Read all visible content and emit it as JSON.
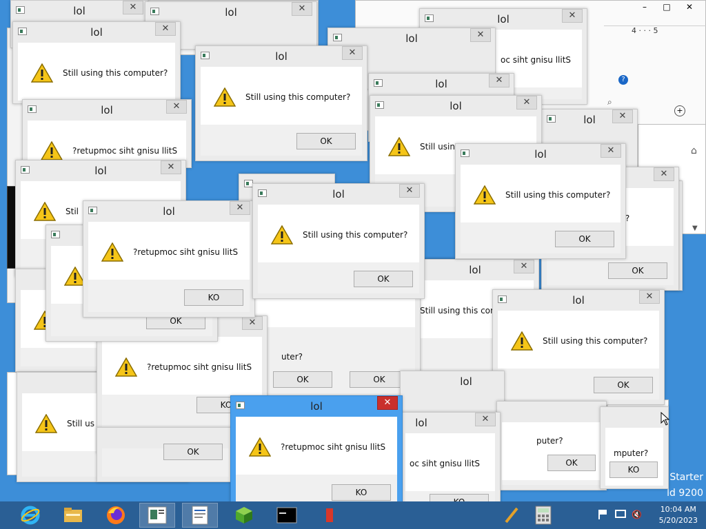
{
  "dialogs": [
    {
      "title": "lol",
      "message": "Still using this computer?",
      "ok": "OK"
    },
    {
      "title": "lol",
      "message": "?retupmoc siht gnisu llitS",
      "ok": "KO"
    }
  ],
  "labels": {
    "still": "Still using this computer?",
    "rev": "?retupmoc siht gnisu llitS",
    "ok": "OK",
    "ko": "KO",
    "lol": "lol"
  },
  "fragments": {
    "f1": "Still usi",
    "f2": "Still using t",
    "f3": "Still using this comp",
    "f4": "Still us",
    "f5": "oc siht gnisu llitS",
    "f6": "moc siht gnisu llitS",
    "f7": "uter?",
    "f8": "mputer?",
    "f9": "puter?",
    "f10": "puter?",
    "f11": "gnisu llitS",
    "f12": "Stil"
  },
  "taskbar": {
    "clock_time": "10:04 AM",
    "clock_date": "5/20/2023",
    "apps": [
      "internet-explorer-icon",
      "file-explorer-icon",
      "firefox-icon",
      "window-app-icon",
      "wordpad-icon",
      "cube-app-icon",
      "console-icon",
      "paint-icon",
      "calculator-icon"
    ]
  },
  "watermark": {
    "line1": "Starter",
    "line2": "ld 9200"
  },
  "ruler": {
    "marks": "4 · · · 5"
  }
}
